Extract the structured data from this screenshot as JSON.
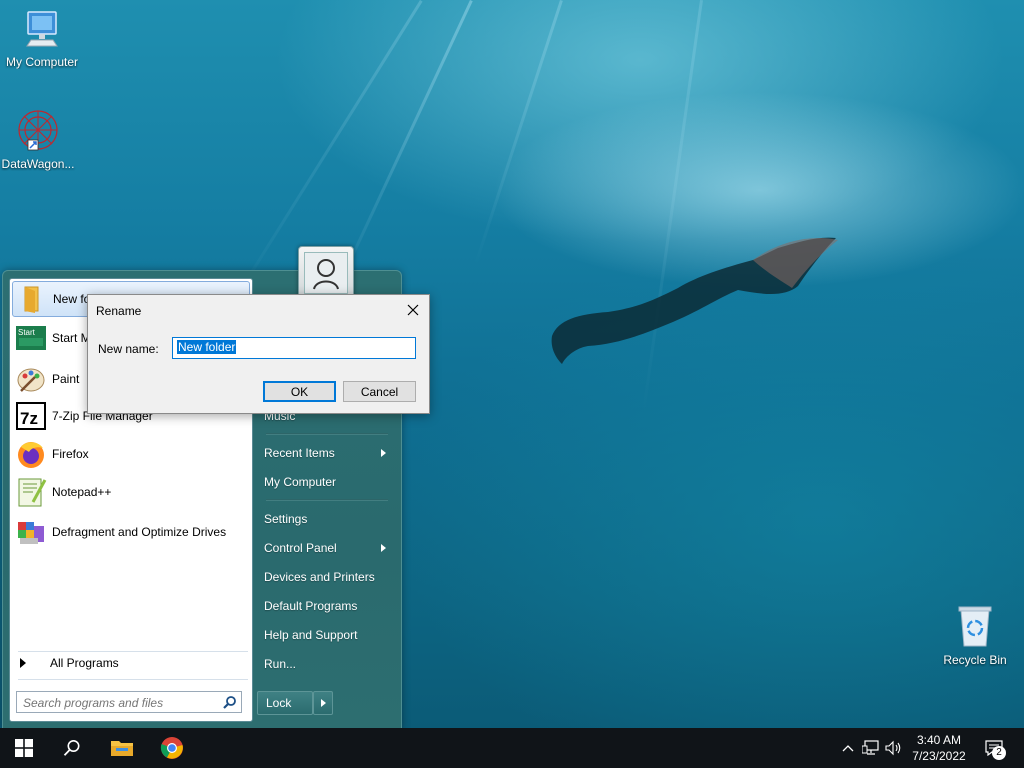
{
  "desktop": {
    "icons": [
      {
        "label": "My Computer",
        "icon": "computer-icon"
      },
      {
        "label": "DataWagon...",
        "icon": "datawagon-icon"
      },
      {
        "label": "Recycle Bin",
        "icon": "recycle-bin-icon"
      }
    ]
  },
  "start_menu": {
    "pinned": [
      {
        "label": "New folder",
        "icon": "folder-icon",
        "selected": true
      },
      {
        "label": "Start Menu",
        "icon": "start-menu-app-icon"
      },
      {
        "label": "Paint",
        "icon": "paint-icon"
      },
      {
        "label": "7-Zip File Manager",
        "icon": "7zip-icon"
      },
      {
        "label": "Firefox",
        "icon": "firefox-icon"
      },
      {
        "label": "Notepad++",
        "icon": "notepadpp-icon"
      },
      {
        "label": "Defragment and Optimize Drives",
        "icon": "defrag-icon"
      }
    ],
    "all_programs": "All Programs",
    "search_placeholder": "Search programs and files",
    "right": {
      "music": "Music",
      "recent_items": "Recent Items",
      "my_computer": "My Computer",
      "settings": "Settings",
      "control_panel": "Control Panel",
      "devices_printers": "Devices and Printers",
      "default_programs": "Default Programs",
      "help_support": "Help and Support",
      "run": "Run..."
    },
    "lock": "Lock"
  },
  "dialog": {
    "title": "Rename",
    "label": "New name:",
    "value": "New folder",
    "ok": "OK",
    "cancel": "Cancel"
  },
  "taskbar": {
    "time": "3:40 AM",
    "date": "7/23/2022",
    "notifications": "2"
  },
  "colors": {
    "accent": "#0078d7",
    "start_menu_frame": "#2c6f72",
    "taskbar": "#101418"
  }
}
